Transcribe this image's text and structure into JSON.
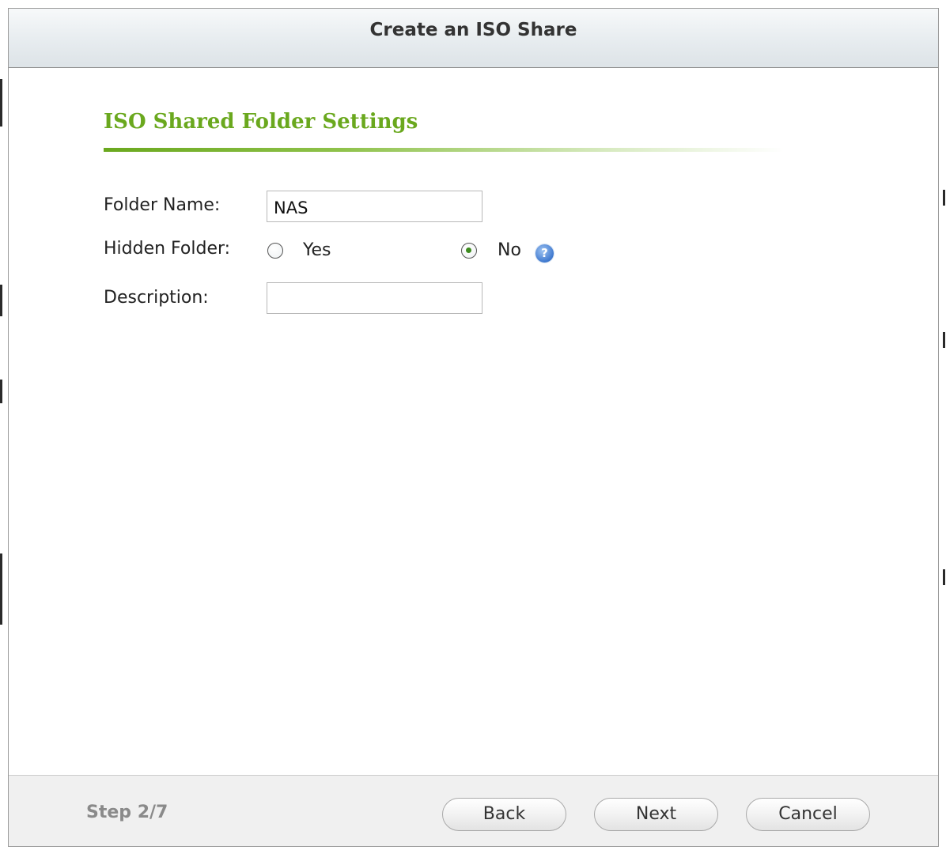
{
  "dialog": {
    "title": "Create an ISO Share"
  },
  "section": {
    "heading": "ISO Shared Folder Settings"
  },
  "form": {
    "folder_name": {
      "label": "Folder Name:",
      "value": "NAS"
    },
    "hidden_folder": {
      "label": "Hidden Folder:",
      "options": [
        {
          "label": "Yes",
          "selected": false
        },
        {
          "label": "No",
          "selected": true
        }
      ]
    },
    "description": {
      "label": "Description:",
      "value": ""
    }
  },
  "help_icon": {
    "icon": "help-icon",
    "glyph": "?"
  },
  "footer": {
    "step": "Step 2/7",
    "back_label": "Back",
    "next_label": "Next",
    "cancel_label": "Cancel"
  },
  "colors": {
    "accent_green": "#6aa81e",
    "help_blue": "#3f79cf"
  }
}
